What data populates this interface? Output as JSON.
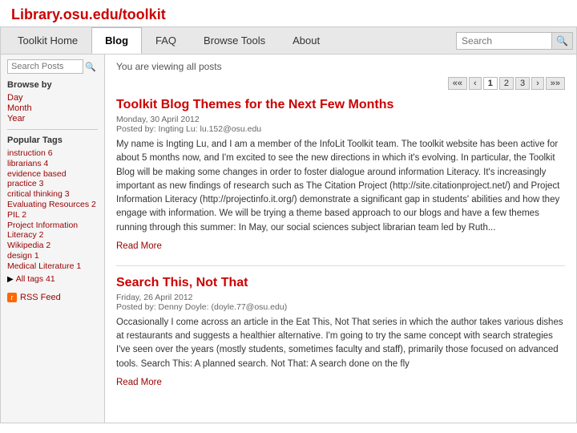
{
  "site": {
    "title": "Library.osu.edu/toolkit"
  },
  "nav": {
    "tabs": [
      {
        "label": "Toolkit Home",
        "id": "home",
        "active": false
      },
      {
        "label": "Blog",
        "id": "blog",
        "active": true
      },
      {
        "label": "FAQ",
        "id": "faq",
        "active": false
      },
      {
        "label": "Browse Tools",
        "id": "browse",
        "active": false
      },
      {
        "label": "About",
        "id": "about",
        "active": false
      }
    ],
    "search_placeholder": "Search"
  },
  "sidebar": {
    "search_placeholder": "Search Posts",
    "browse_title": "Browse by",
    "browse_links": [
      "Day",
      "Month",
      "Year"
    ],
    "tags_title": "Popular Tags",
    "tags": [
      {
        "label": "instruction 6"
      },
      {
        "label": "librarians 4"
      },
      {
        "label": "evidence based practice 3"
      },
      {
        "label": "critical thinking 3"
      },
      {
        "label": "Evaluating Resources 2"
      },
      {
        "label": "PIL 2"
      },
      {
        "label": "Project Information Literacy 2"
      },
      {
        "label": "Wikipedia 2"
      },
      {
        "label": "design 1"
      },
      {
        "label": "Medical Literature 1"
      }
    ],
    "all_tags_label": "All tags 41",
    "rss_label": "RSS Feed"
  },
  "content": {
    "viewing_label": "You are viewing all posts",
    "pagination": {
      "prev_prev": "««",
      "prev": "‹",
      "pages": [
        "1",
        "2",
        "3"
      ],
      "next": "›",
      "next_next": "»»",
      "active_page": "1"
    },
    "posts": [
      {
        "title": "Toolkit Blog Themes for the Next Few Months",
        "date": "Monday, 30 April 2012",
        "author": "Posted by: Ingting Lu: lu.152@osu.edu",
        "body": "My name is Ingting Lu, and I am a member of the InfoLit Toolkit team. The toolkit website has been active for about 5 months now, and I'm excited to see the new directions in which it's evolving. In particular, the Toolkit Blog will be making some changes in order to foster dialogue around information Literacy. It's increasingly important as new findings of research such as The Citation Project (http://site.citationproject.net/) and Project Information Literacy (http://projectinfo.it.org/) demonstrate a significant gap in students' abilities and how they engage with information. We will be trying a theme based approach to our blogs and have a few themes running through this summer: In May, our social sciences subject librarian team led by Ruth...",
        "read_more": "Read More"
      },
      {
        "title": "Search This, Not That",
        "date": "Friday, 26 April 2012",
        "author": "Posted by: Denny Doyle: (doyle.77@osu.edu)",
        "body": "Occasionally I come across an article in the Eat This, Not That series in which the author takes various dishes at restaurants and suggests a healthier alternative. I'm going to try the same concept with search strategies I've seen over the years (mostly students, sometimes faculty and staff), primarily those focused on advanced tools. Search This: A planned search. Not That: A search done on the fly",
        "read_more": "Read More"
      }
    ]
  }
}
